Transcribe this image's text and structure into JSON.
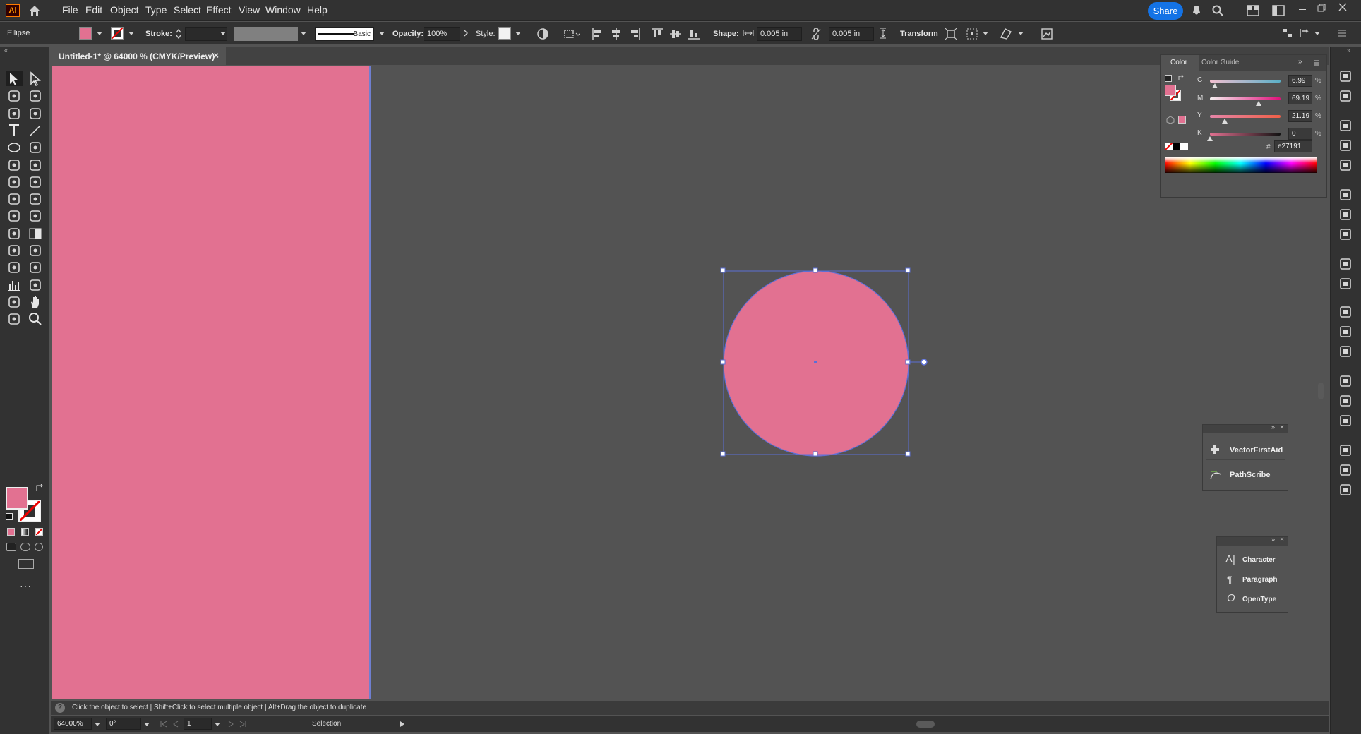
{
  "app": {
    "logo": "Ai"
  },
  "menu": [
    "File",
    "Edit",
    "Object",
    "Type",
    "Select",
    "Effect",
    "View",
    "Window",
    "Help"
  ],
  "header": {
    "share_label": "Share"
  },
  "control_bar": {
    "object_type": "Ellipse",
    "stroke_label": "Stroke:",
    "brush_label": "Basic",
    "opacity_label": "Opacity:",
    "opacity_value": "100%",
    "style_label": "Style:",
    "shape_label": "Shape:",
    "width_value": "0.005 in",
    "height_value": "0.005 in",
    "transform_label": "Transform"
  },
  "document": {
    "tab_title": "Untitled-1* @ 64000 % (CMYK/Preview)",
    "close_glyph": "×"
  },
  "color_panel": {
    "tab_color": "Color",
    "tab_guide": "Color Guide",
    "fill_color": "#e27191",
    "channels": [
      {
        "label": "C",
        "value": "6.99",
        "fraction": 0.07
      },
      {
        "label": "M",
        "value": "69.19",
        "fraction": 0.69
      },
      {
        "label": "Y",
        "value": "21.19",
        "fraction": 0.21
      },
      {
        "label": "K",
        "value": "0",
        "fraction": 0.0
      }
    ],
    "percent": "%",
    "hex_prefix": "#",
    "hex_value": "e27191"
  },
  "plugin_panel": {
    "items": [
      "VectorFirstAid",
      "PathScribe"
    ]
  },
  "type_panel": {
    "items": [
      "Character",
      "Paragraph",
      "OpenType"
    ]
  },
  "hint_bar": {
    "text": "Click the object to select  |  Shift+Click to select multiple object  |  Alt+Drag the object to duplicate"
  },
  "status_bar": {
    "zoom": "64000%",
    "rotation": "0°",
    "artboard_number": "1",
    "tool_name": "Selection"
  },
  "icons": [
    "home-icon",
    "bell-icon",
    "search-icon",
    "workspace-icon",
    "minimize-icon",
    "restore-icon",
    "close-icon"
  ]
}
